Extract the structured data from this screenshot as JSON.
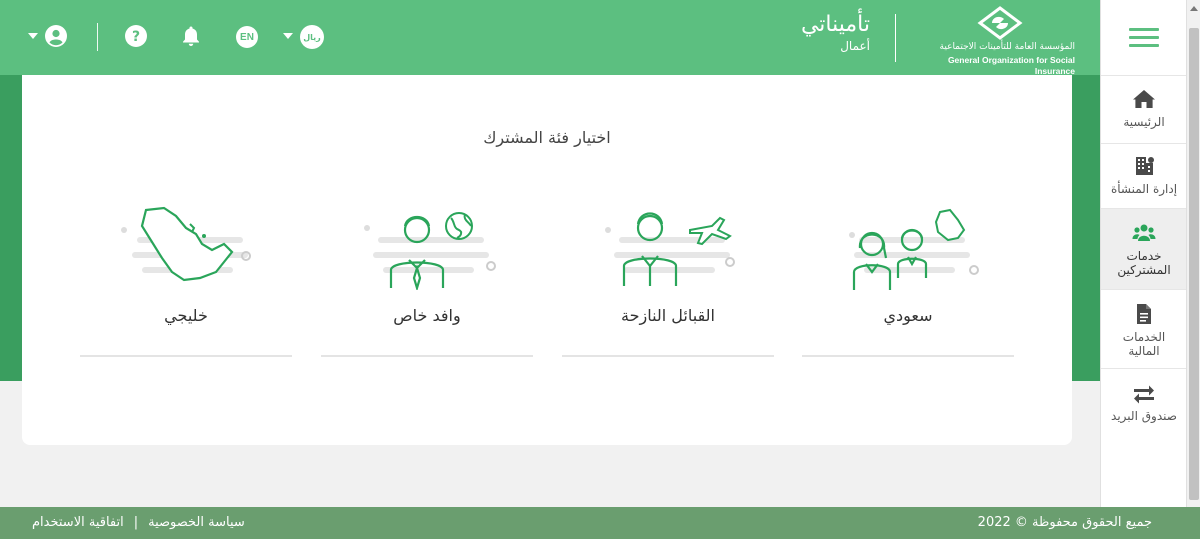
{
  "header": {
    "language_label": "EN",
    "currency_label": "ريال",
    "brand_title": "تأميناتي",
    "brand_subtitle": "أعمال",
    "org_name_ar": "المؤسسة العامة للتأمينات الاجتماعية",
    "org_name_en": "General Organization for Social Insurance",
    "icons": [
      "user-icon",
      "help-icon",
      "notification-bell-icon",
      "language-badge",
      "currency-badge"
    ]
  },
  "main": {
    "title": "اختيار فئة المشترك",
    "categories": [
      {
        "label": "سعودي",
        "icon": "saudi-family-icon"
      },
      {
        "label": "القبائل النازحة",
        "icon": "migrant-tribes-icon"
      },
      {
        "label": "وافد خاص",
        "icon": "expat-icon"
      },
      {
        "label": "خليجي",
        "icon": "gulf-map-icon"
      }
    ]
  },
  "sidebar": {
    "items": [
      {
        "label": "الرئيسية",
        "icon": "home-icon"
      },
      {
        "label": "إدارة المنشأة",
        "icon": "building-icon"
      },
      {
        "label": "خدمات المشتركين",
        "icon": "users-icon",
        "active": true
      },
      {
        "label": "الخدمات المالية",
        "icon": "document-icon"
      },
      {
        "label": "صندوق البريد",
        "icon": "arrows-exchange-icon"
      }
    ]
  },
  "footer": {
    "copyright": "جميع الحقوق محفوظة © 2022",
    "privacy_label": "سياسة الخصوصية",
    "separator": "|",
    "terms_label": "اتفاقية الاستخدام"
  },
  "colors": {
    "primary": "#5cbf80",
    "band": "#3a9e5f",
    "footer": "#6a9e6f",
    "illustration": "#2aa55a"
  }
}
